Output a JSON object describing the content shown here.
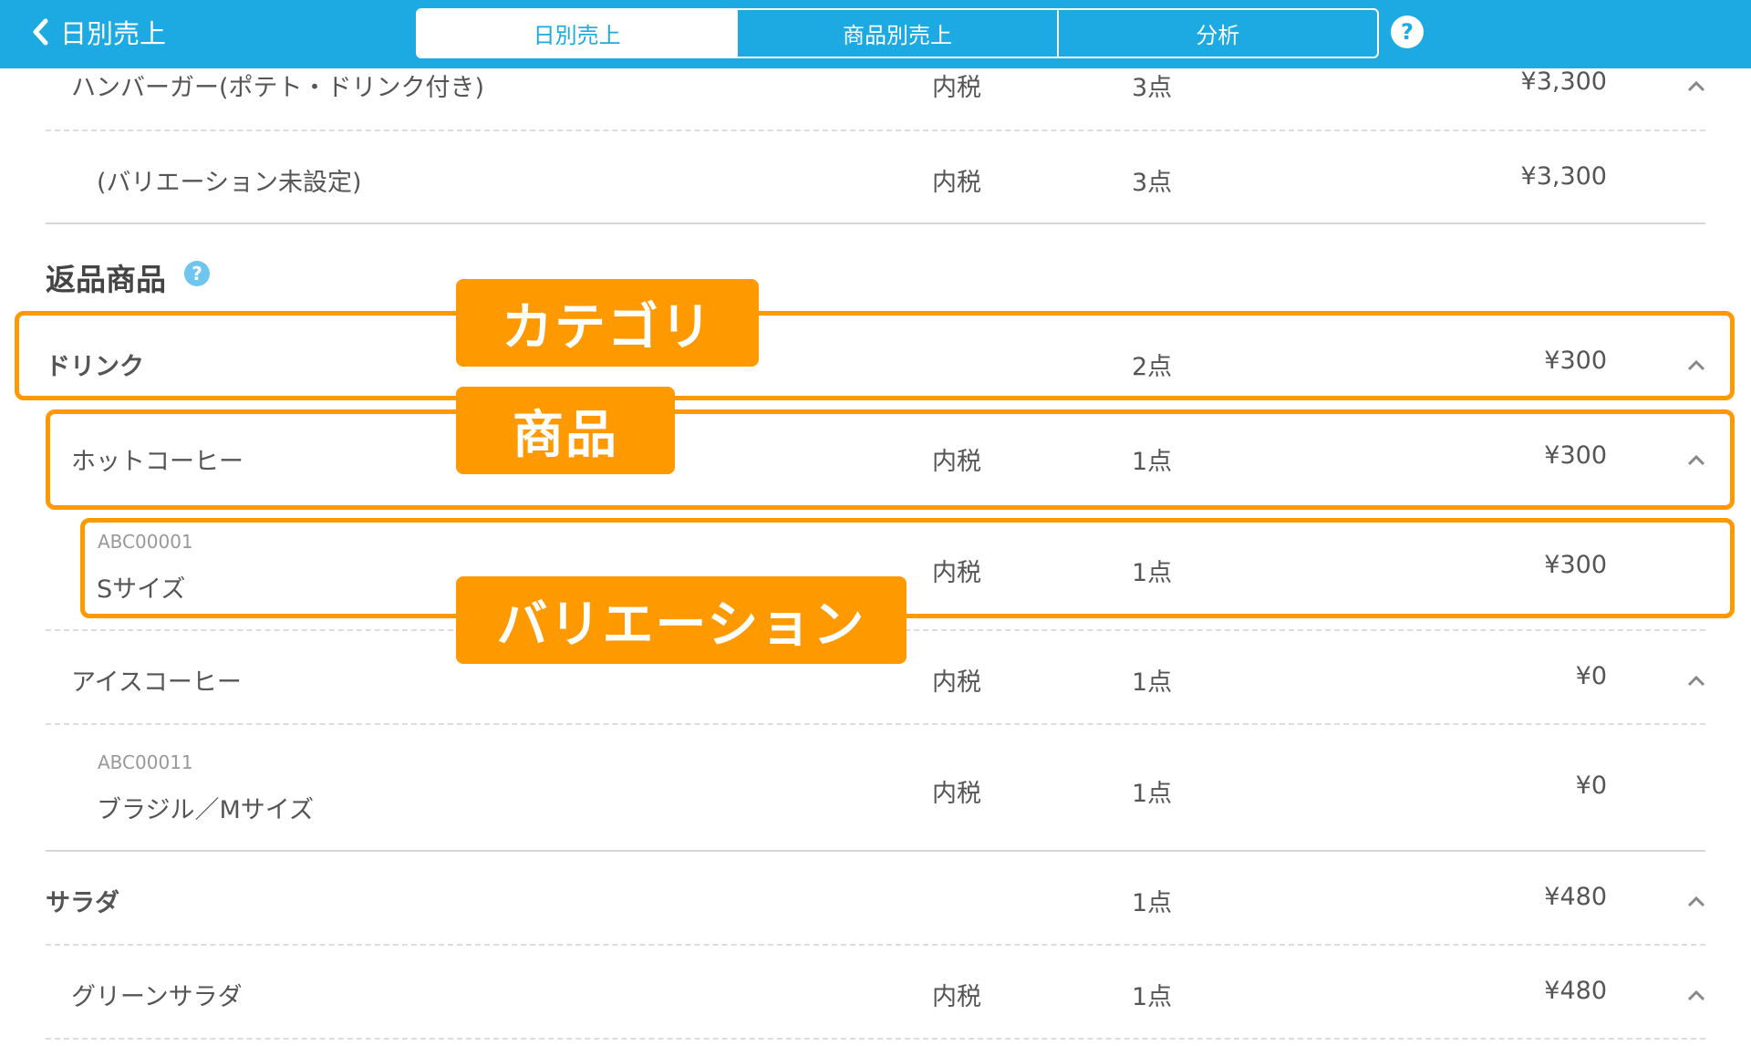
{
  "header": {
    "back_label": "日別売上",
    "tabs": [
      {
        "label": "日別売上",
        "active": true
      },
      {
        "label": "商品別売上",
        "active": false
      },
      {
        "label": "分析",
        "active": false
      }
    ],
    "help_label": "?"
  },
  "rows": {
    "r1": {
      "name": "ハンバーガー(ポテト・ドリンク付き)",
      "tax": "内税",
      "qty": "3点",
      "amount": "¥3,300"
    },
    "r2": {
      "name": "(バリエーション未設定)",
      "tax": "内税",
      "qty": "3点",
      "amount": "¥3,300"
    }
  },
  "returns": {
    "title": "返品商品",
    "help": "?",
    "drink": {
      "name": "ドリンク",
      "qty": "2点",
      "amount": "¥300"
    },
    "hot": {
      "name": "ホットコーヒー",
      "tax": "内税",
      "qty": "1点",
      "amount": "¥300"
    },
    "hot_var": {
      "code": "ABC00001",
      "name": "Sサイズ",
      "tax": "内税",
      "qty": "1点",
      "amount": "¥300"
    },
    "ice": {
      "name": "アイスコーヒー",
      "tax": "内税",
      "qty": "1点",
      "amount": "¥0"
    },
    "ice_var": {
      "code": "ABC00011",
      "name": "ブラジル／Mサイズ",
      "tax": "内税",
      "qty": "1点",
      "amount": "¥0"
    },
    "salad": {
      "name": "サラダ",
      "qty": "1点",
      "amount": "¥480"
    },
    "green": {
      "name": "グリーンサラダ",
      "tax": "内税",
      "qty": "1点",
      "amount": "¥480"
    }
  },
  "annotations": {
    "category": "カテゴリ",
    "product": "商品",
    "variation": "バリエーション"
  },
  "colors": {
    "header": "#1da9e1",
    "annotation": "#ff9900"
  }
}
